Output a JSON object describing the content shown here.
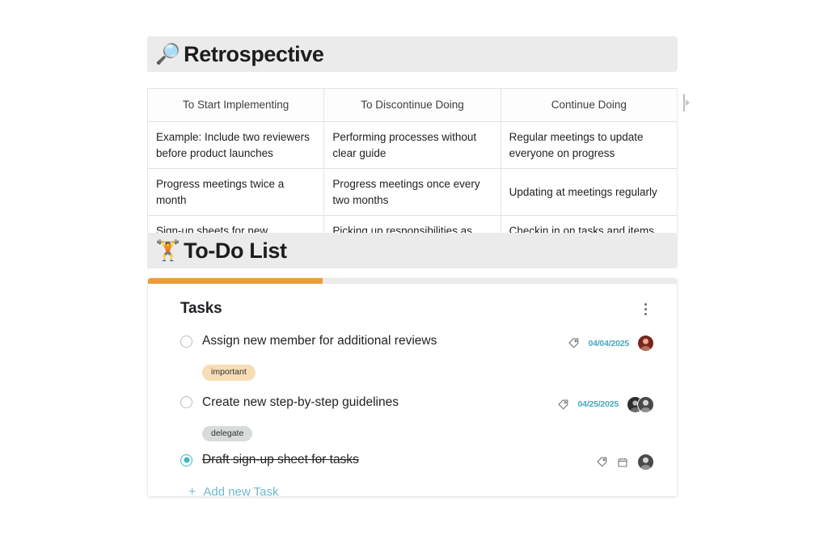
{
  "sections": {
    "retrospective": {
      "emoji": "🔎",
      "emoji_name": "magnifying-glass",
      "title": "Retrospective"
    },
    "todo": {
      "emoji": "🏋️",
      "emoji_name": "weightlifter",
      "title": "To-Do List"
    }
  },
  "retro_table": {
    "headers": [
      "To Start Implementing",
      "To Discontinue Doing",
      "Continue Doing"
    ],
    "rows": [
      [
        "Example: Include two reviewers before product launches",
        "Performing processes without clear guide",
        "Regular meetings to update everyone on progress"
      ],
      [
        "Progress meetings twice a month",
        "Progress meetings once every two months",
        "Updating at meetings regularly"
      ],
      [
        "Sign-up sheets for new responsibilities",
        "Picking up responsibilities as they come up",
        "Checkin in on tasks and items that need attention"
      ]
    ]
  },
  "tasks_card": {
    "title": "Tasks",
    "progress_percent": 33,
    "progress_color": "#ed9b3b",
    "menu_icon": "kebab-menu-icon",
    "accent_color": "#4aa7bd",
    "add_task": {
      "plus": "+",
      "label": "Add new Task"
    },
    "items": [
      {
        "text": "Assign new member for additional reviews",
        "done": false,
        "tag_icon": "tag-icon",
        "has_calendar_icon": false,
        "date": "04/04/2025",
        "chip": {
          "label": "important",
          "color": "#f7ddb6"
        },
        "avatars": [
          "av-red"
        ]
      },
      {
        "text": "Create new step-by-step guidelines",
        "done": false,
        "tag_icon": "tag-icon",
        "has_calendar_icon": false,
        "date": "04/25/2025",
        "chip": {
          "label": "delegate",
          "color": "#d8dbdb"
        },
        "avatars": [
          "av-dark",
          "av-gray"
        ]
      },
      {
        "text": "Draft sign-up sheet for tasks",
        "done": true,
        "tag_icon": "tag-icon",
        "has_calendar_icon": true,
        "date": "",
        "chip": null,
        "avatars": [
          "av-gray"
        ]
      }
    ]
  }
}
